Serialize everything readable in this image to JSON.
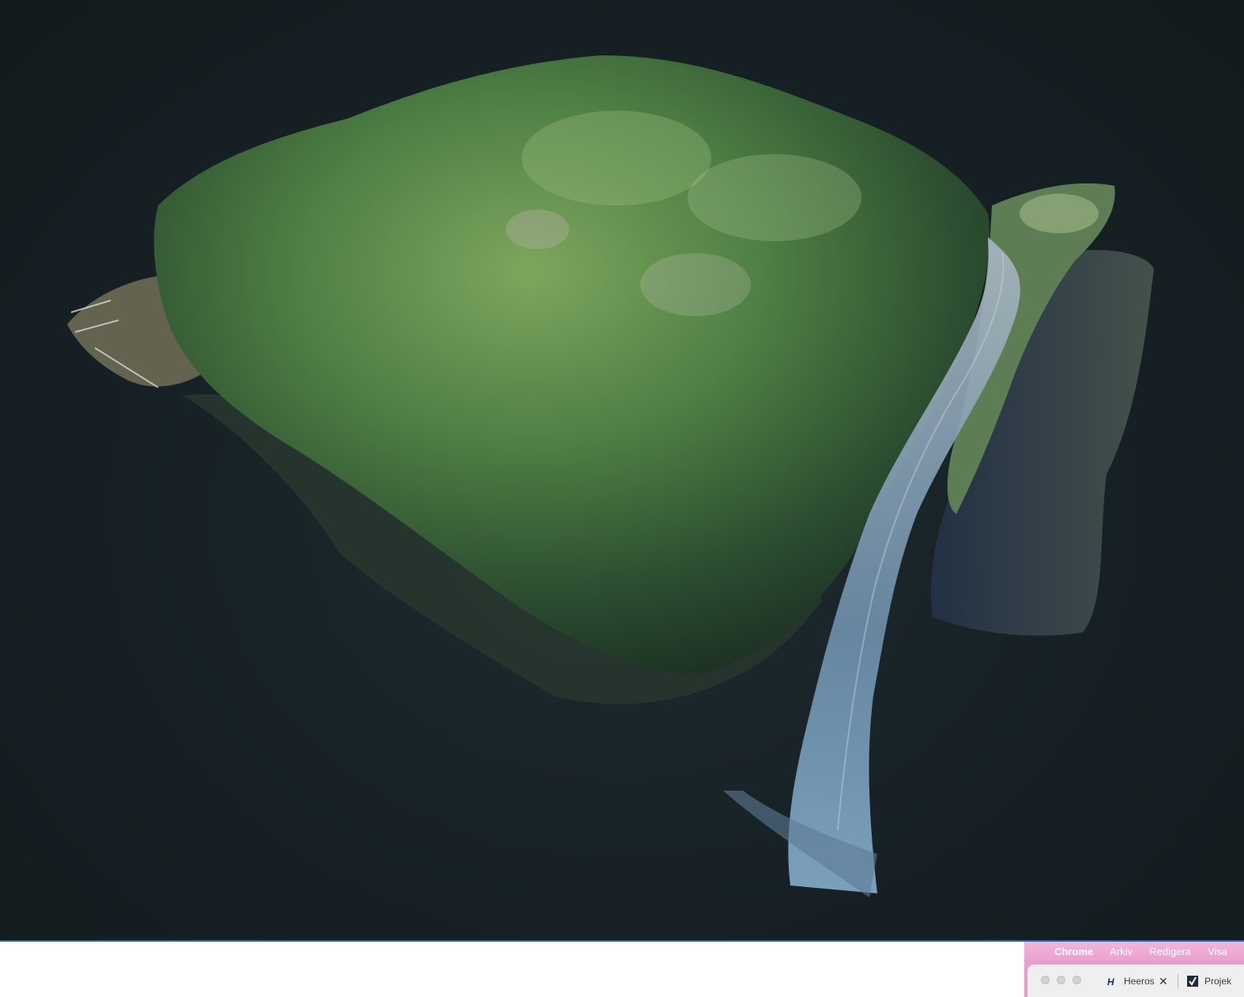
{
  "viewer": {
    "colors": {
      "background": "#172125",
      "forest_dark": "#1f3a24",
      "forest_mid": "#3e6b3a",
      "forest_light": "#8fb072",
      "road": "#7f9db6",
      "shadow_area": "#3a4a47"
    }
  },
  "menubar": {
    "apple_icon": "apple-icon",
    "app_name": "Chrome",
    "items": [
      "Arkiv",
      "Redigera",
      "Visa"
    ],
    "color": "#f0addb"
  },
  "tabs": [
    {
      "title": "Heeros",
      "favicon": "heeros-h-icon",
      "closable": true
    },
    {
      "title": "Projek",
      "favicon": "checkmark-logo-icon",
      "closable": false
    }
  ]
}
